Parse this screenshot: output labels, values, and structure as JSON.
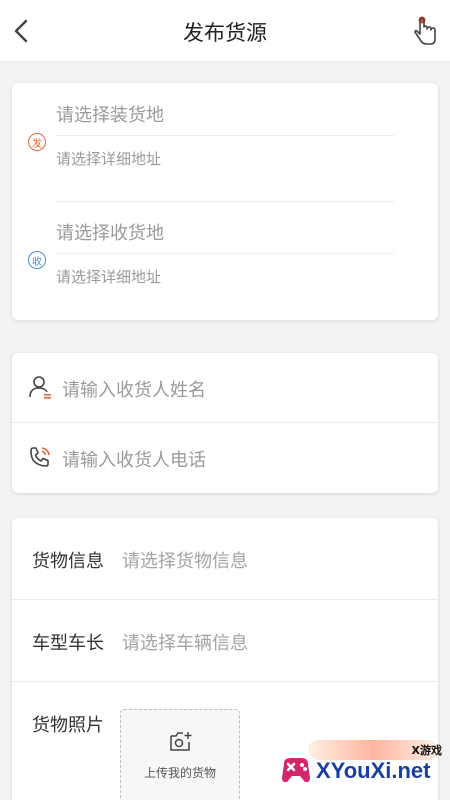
{
  "header": {
    "title": "发布货源"
  },
  "route": {
    "send": {
      "badge": "发",
      "main_placeholder": "请选择装货地",
      "detail_placeholder": "请选择详细地址"
    },
    "receive": {
      "badge": "收",
      "main_placeholder": "请选择收货地",
      "detail_placeholder": "请选择详细地址"
    }
  },
  "receiver": {
    "name_placeholder": "请输入收货人姓名",
    "phone_placeholder": "请输入收货人电话"
  },
  "goods": {
    "cargo_label": "货物信息",
    "cargo_placeholder": "请选择货物信息",
    "vehicle_label": "车型车长",
    "vehicle_placeholder": "请选择车辆信息",
    "photo_label": "货物照片",
    "upload_label": "上传我的货物"
  },
  "watermark": {
    "top": "X游戏",
    "text": "XYouXi.net"
  },
  "colors": {
    "send_badge": "#e8663b",
    "receive_badge": "#4a90d9",
    "accent": "#e8663b"
  }
}
